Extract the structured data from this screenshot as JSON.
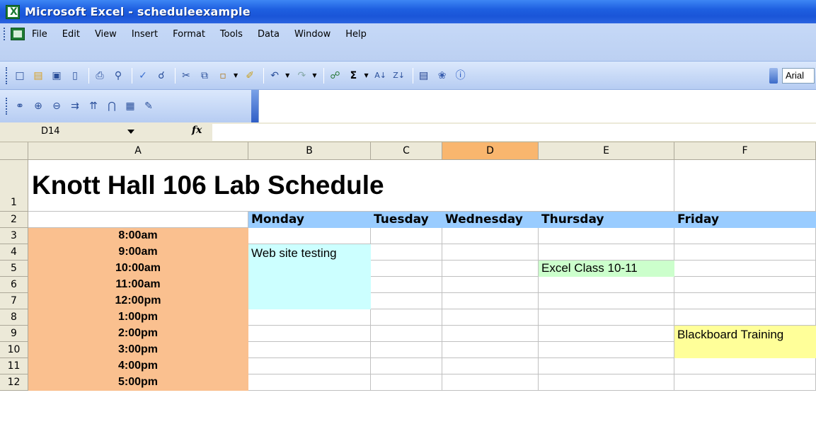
{
  "window": {
    "title": "Microsoft Excel - scheduleexample"
  },
  "menu": [
    "File",
    "Edit",
    "View",
    "Insert",
    "Format",
    "Tools",
    "Data",
    "Window",
    "Help"
  ],
  "toolbar": {
    "font_name": "Arial"
  },
  "formula_bar": {
    "cell_ref": "D14",
    "fx_label": "fx",
    "content": ""
  },
  "columns": [
    "A",
    "B",
    "C",
    "D",
    "E",
    "F"
  ],
  "active_column": "D",
  "rows": [
    "1",
    "2",
    "3",
    "4",
    "5",
    "6",
    "7",
    "8",
    "9",
    "10",
    "11",
    "12"
  ],
  "sheet": {
    "title": "Knott Hall 106 Lab Schedule",
    "days": [
      "Monday",
      "Tuesday",
      "Wednesday",
      "Thursday",
      "Friday"
    ],
    "times": [
      "8:00am",
      "9:00am",
      "10:00am",
      "11:00am",
      "12:00pm",
      "1:00pm",
      "2:00pm",
      "3:00pm",
      "4:00pm",
      "5:00pm"
    ],
    "events": [
      {
        "text": "Web site testing",
        "color": "#ccffff"
      },
      {
        "text": "Excel Class 10-11",
        "color": "#ccffcc"
      },
      {
        "text": "Blackboard Training",
        "color": "#ffff99"
      }
    ]
  },
  "colors": {
    "time_fill": "#fac08f",
    "day_fill": "#99ccff",
    "active_header": "#f9b66e"
  }
}
